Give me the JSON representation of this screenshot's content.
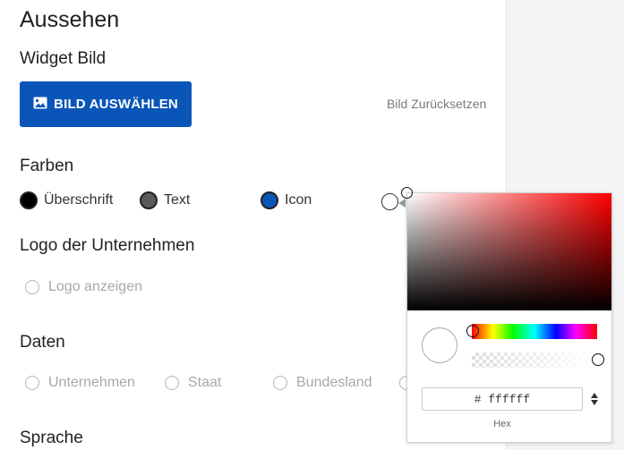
{
  "section_title": "Aussehen",
  "widget_image": {
    "title": "Widget Bild",
    "select_button": "BILD AUSWÄHLEN",
    "reset_link": "Bild Zurücksetzen"
  },
  "colors": {
    "title": "Farben",
    "options": [
      {
        "label": "Überschrift",
        "color": "#000000"
      },
      {
        "label": "Text",
        "color": "#595959"
      },
      {
        "label": "Icon",
        "color": "#0a56b8"
      }
    ]
  },
  "logo": {
    "title": "Logo der Unternehmen",
    "show_option": "Logo anzeigen"
  },
  "data_section": {
    "title": "Daten",
    "options": [
      "Unternehmen",
      "Staat",
      "Bundesland"
    ]
  },
  "language": {
    "title": "Sprache"
  },
  "color_picker": {
    "hex_value": "# ffffff",
    "mode_label": "Hex",
    "current_color": "#ffffff",
    "hue": 0,
    "alpha": 1
  },
  "accent_color": "#0a56b8"
}
